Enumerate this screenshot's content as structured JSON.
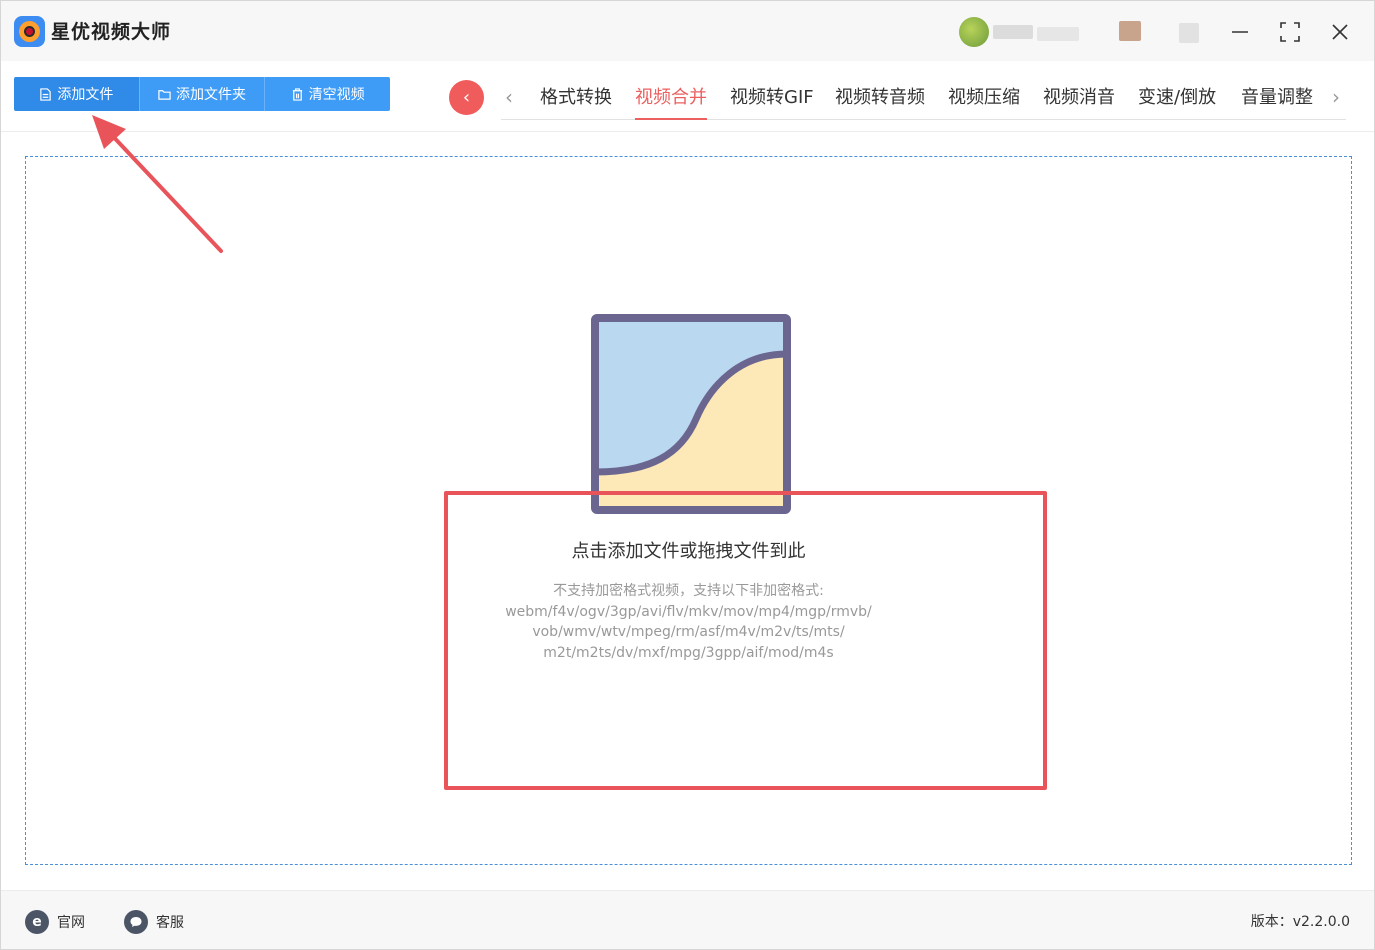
{
  "app": {
    "title": "星优视频大师",
    "version_label": "版本：v2.2.0.0"
  },
  "window_controls": {
    "minimize": "—",
    "maximize": "⛶",
    "close": "✕"
  },
  "toolbar": {
    "add_file": "添加文件",
    "add_folder": "添加文件夹",
    "clear_video": "清空视频"
  },
  "tabs": {
    "back": "‹",
    "prev": "‹",
    "next": "›",
    "items": [
      "格式转换",
      "视频合并",
      "视频转GIF",
      "视频转音频",
      "视频压缩",
      "视频消音",
      "变速/倒放",
      "音量调整"
    ],
    "active": "视频合并"
  },
  "drop": {
    "title": "点击添加文件或拖拽文件到此",
    "hint_lines": [
      "不支持加密格式视频，支持以下非加密格式:",
      "webm/f4v/ogv/3gp/avi/flv/mkv/mov/mp4/mgp/rmvb/",
      "vob/wmv/wtv/mpeg/rm/asf/m4v/m2v/ts/mts/",
      "m2t/m2ts/dv/mxf/mpg/3gpp/aif/mod/m4s"
    ]
  },
  "footer": {
    "website": "官网",
    "service": "客服",
    "website_icon": "e",
    "service_icon": "chat-bubble-icon"
  },
  "colors": {
    "accent_blue": "#3e9bf6",
    "accent_red": "#ec5f5f",
    "highlight": "#e9545b"
  }
}
